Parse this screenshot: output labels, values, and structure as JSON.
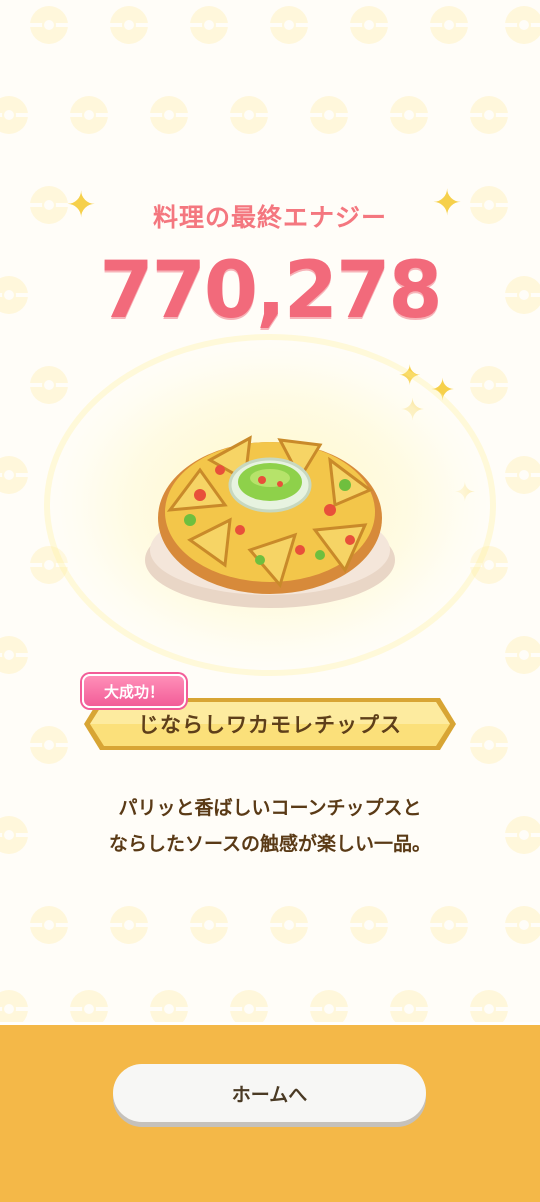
{
  "result": {
    "energy_label": "料理の最終エナジー",
    "energy_value": "770,278",
    "badge_label": "大成功！",
    "dish_name": "じならしワカモレチップス",
    "description_line1": "パリッと香ばしいコーンチップスと",
    "description_line2": "ならしたソースの触感が楽しい一品。"
  },
  "footer": {
    "home_button_label": "ホームへ"
  },
  "icons": [
    "sparkle-icon",
    "pokeball-pattern-icon",
    "dish-image"
  ],
  "colors": {
    "energy_pink": "#f26a7b",
    "badge_pink": "#f25d98",
    "banner_gold": "#f8d56a",
    "footer_orange": "#f4b848",
    "text_brown": "#5a3a16"
  }
}
